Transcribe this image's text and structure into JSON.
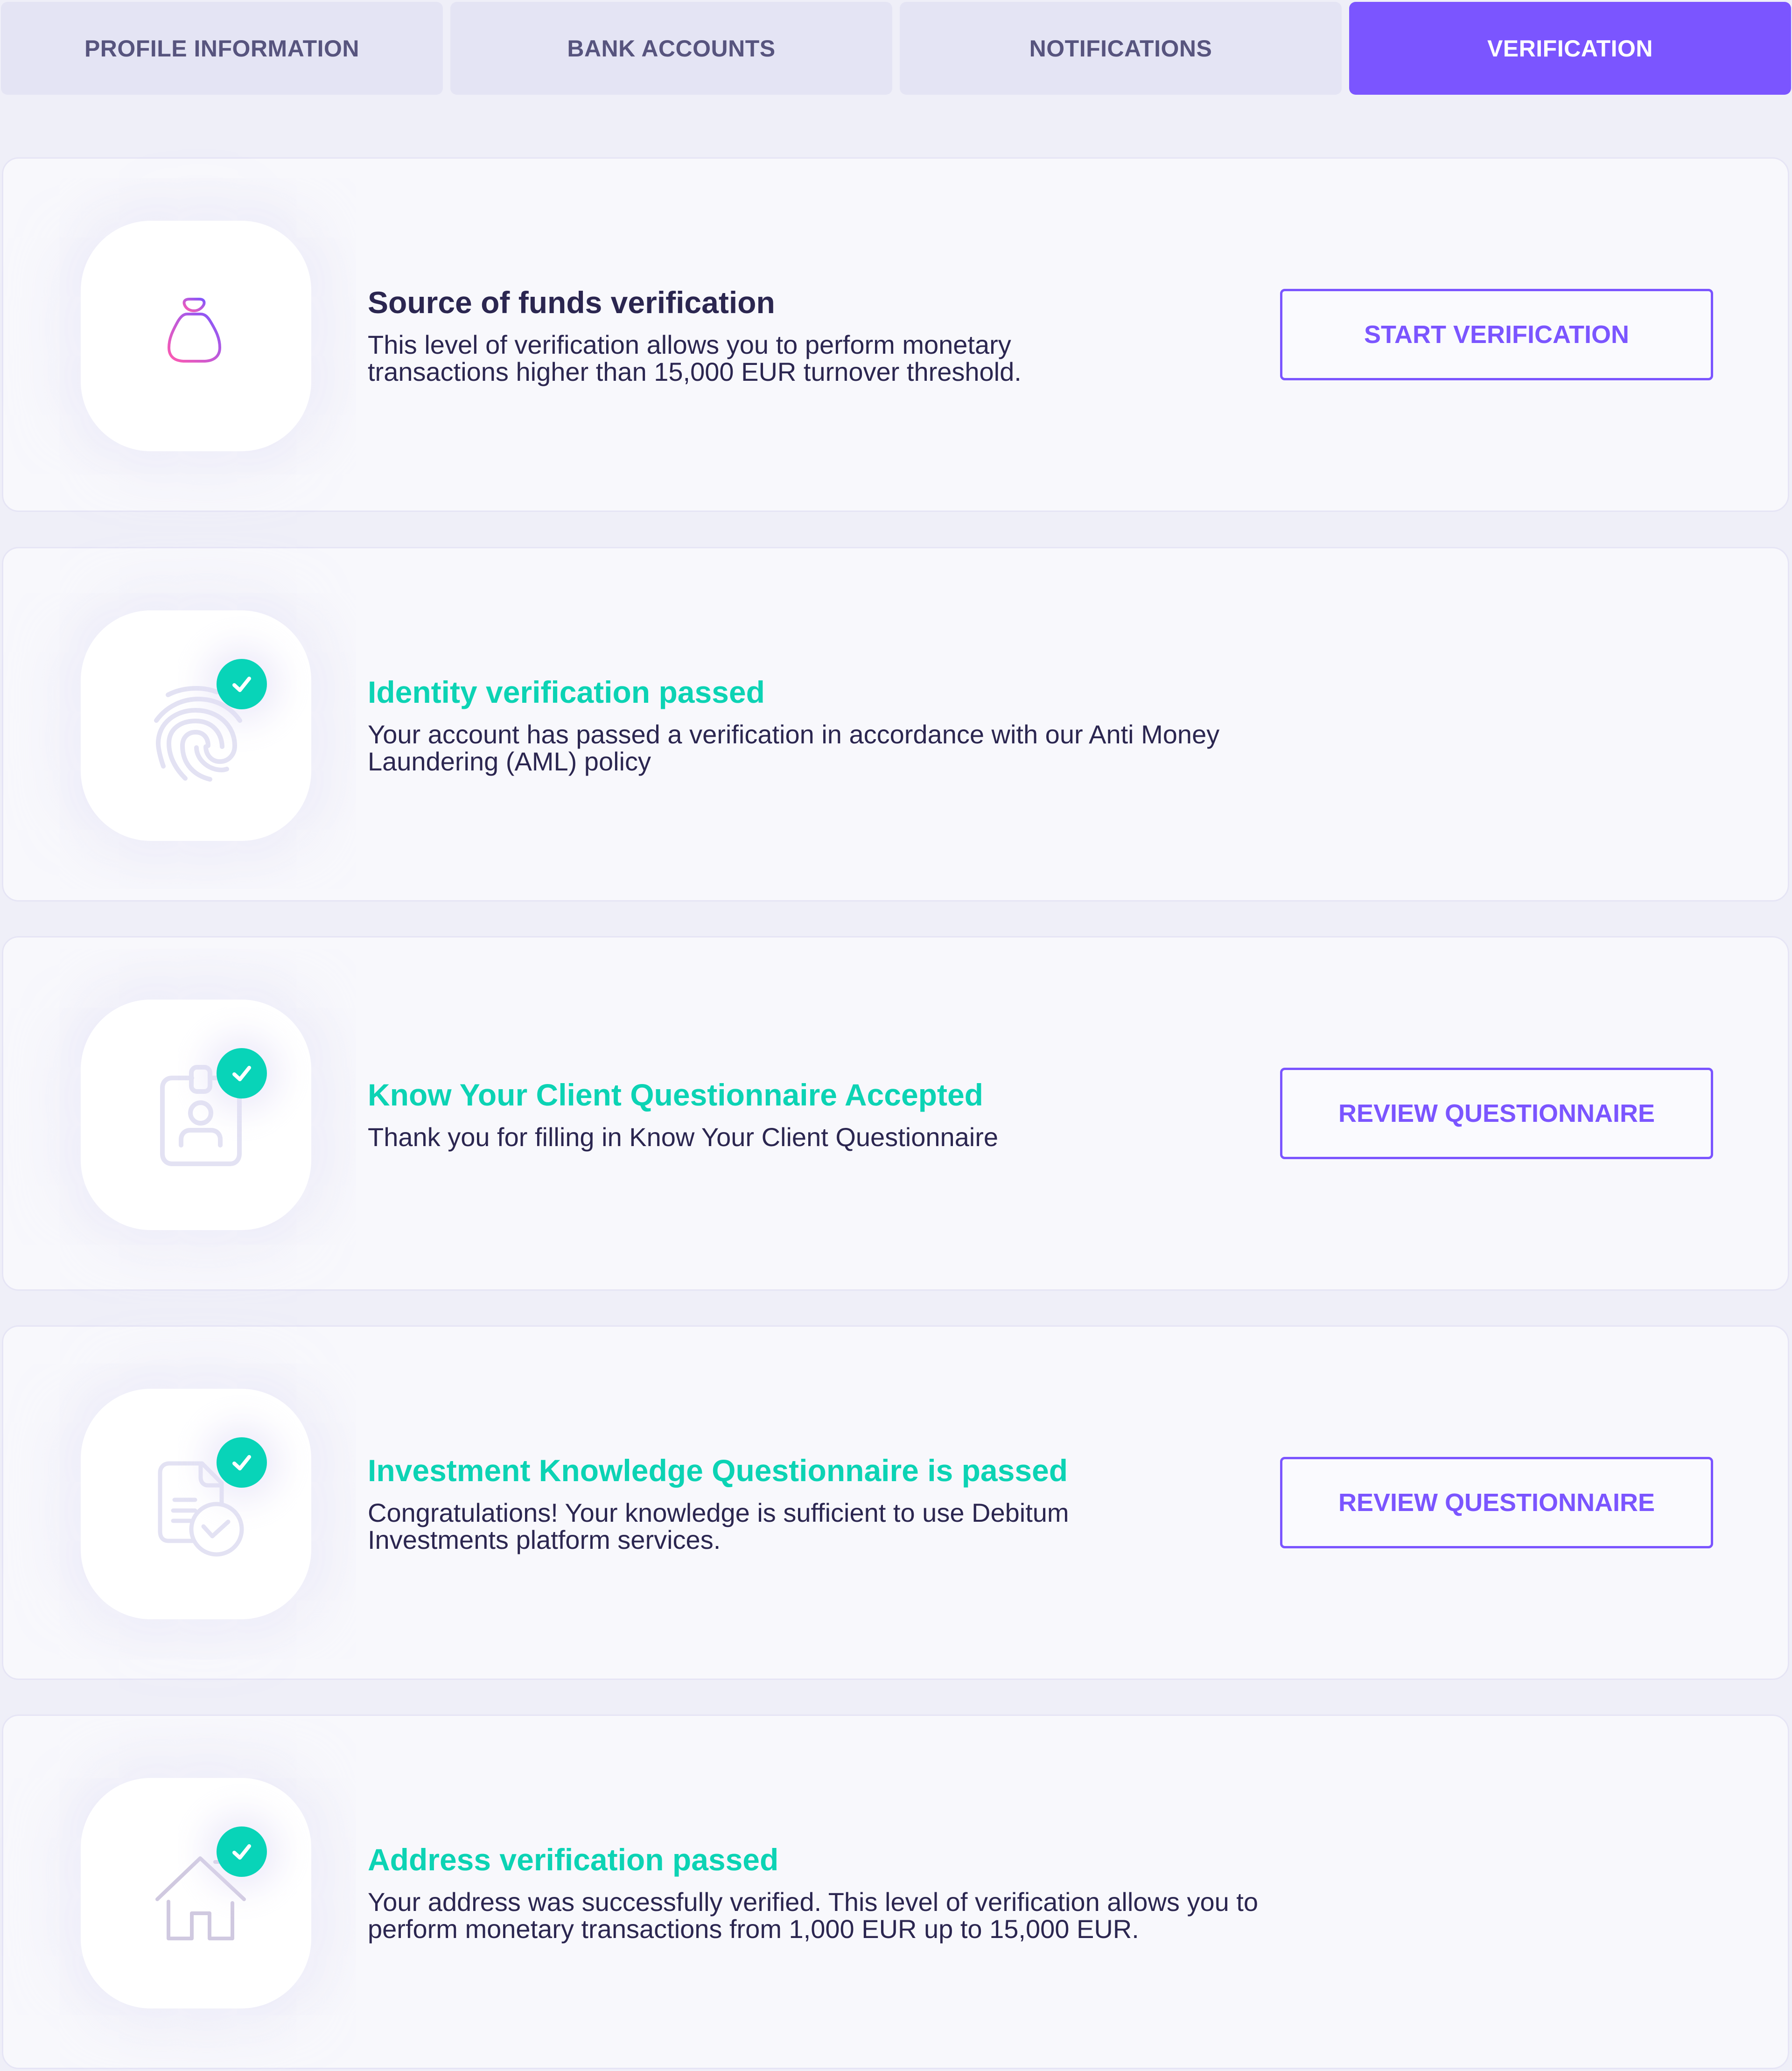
{
  "tabs": [
    {
      "label": "PROFILE INFORMATION",
      "active": false
    },
    {
      "label": "BANK ACCOUNTS",
      "active": false
    },
    {
      "label": "NOTIFICATIONS",
      "active": false
    },
    {
      "label": "VERIFICATION",
      "active": true
    }
  ],
  "colors": {
    "accent": "#7B55FF",
    "success": "#0CD3B4",
    "text_dark": "#2B2650",
    "tab_text": "#57547E",
    "tab_bg": "#E4E4F4",
    "page_bg": "#EFEFF8",
    "card_bg": "#F8F8FC",
    "icon_muted": "#E3E2F3"
  },
  "cards": [
    {
      "icon": "money-bag-icon",
      "status": "pending",
      "title": "Source of funds verification",
      "description": "This level of verification allows you to perform monetary transactions higher than 15,000 EUR turnover threshold.",
      "button_label": "START VERIFICATION"
    },
    {
      "icon": "fingerprint-icon",
      "status": "passed",
      "badge": "check-icon",
      "title": "Identity verification passed",
      "description": "Your account has passed a verification in accordance with our Anti Money Laundering (AML) policy"
    },
    {
      "icon": "id-badge-icon",
      "status": "passed",
      "badge": "check-icon",
      "title": "Know Your Client Questionnaire Accepted",
      "description": "Thank you for filling in Know Your Client Questionnaire",
      "button_label": "REVIEW QUESTIONNAIRE"
    },
    {
      "icon": "document-check-icon",
      "status": "passed",
      "badge": "check-icon",
      "title": "Investment Knowledge Questionnaire is passed",
      "description": "Congratulations! Your knowledge is sufficient to use Debitum Investments platform services.",
      "button_label": "REVIEW QUESTIONNAIRE"
    },
    {
      "icon": "house-icon",
      "status": "passed",
      "badge": "check-icon",
      "title": "Address verification passed",
      "description": "Your address was successfully verified. This level of verification allows you to perform monetary transactions from 1,000 EUR up to 15,000 EUR."
    }
  ]
}
